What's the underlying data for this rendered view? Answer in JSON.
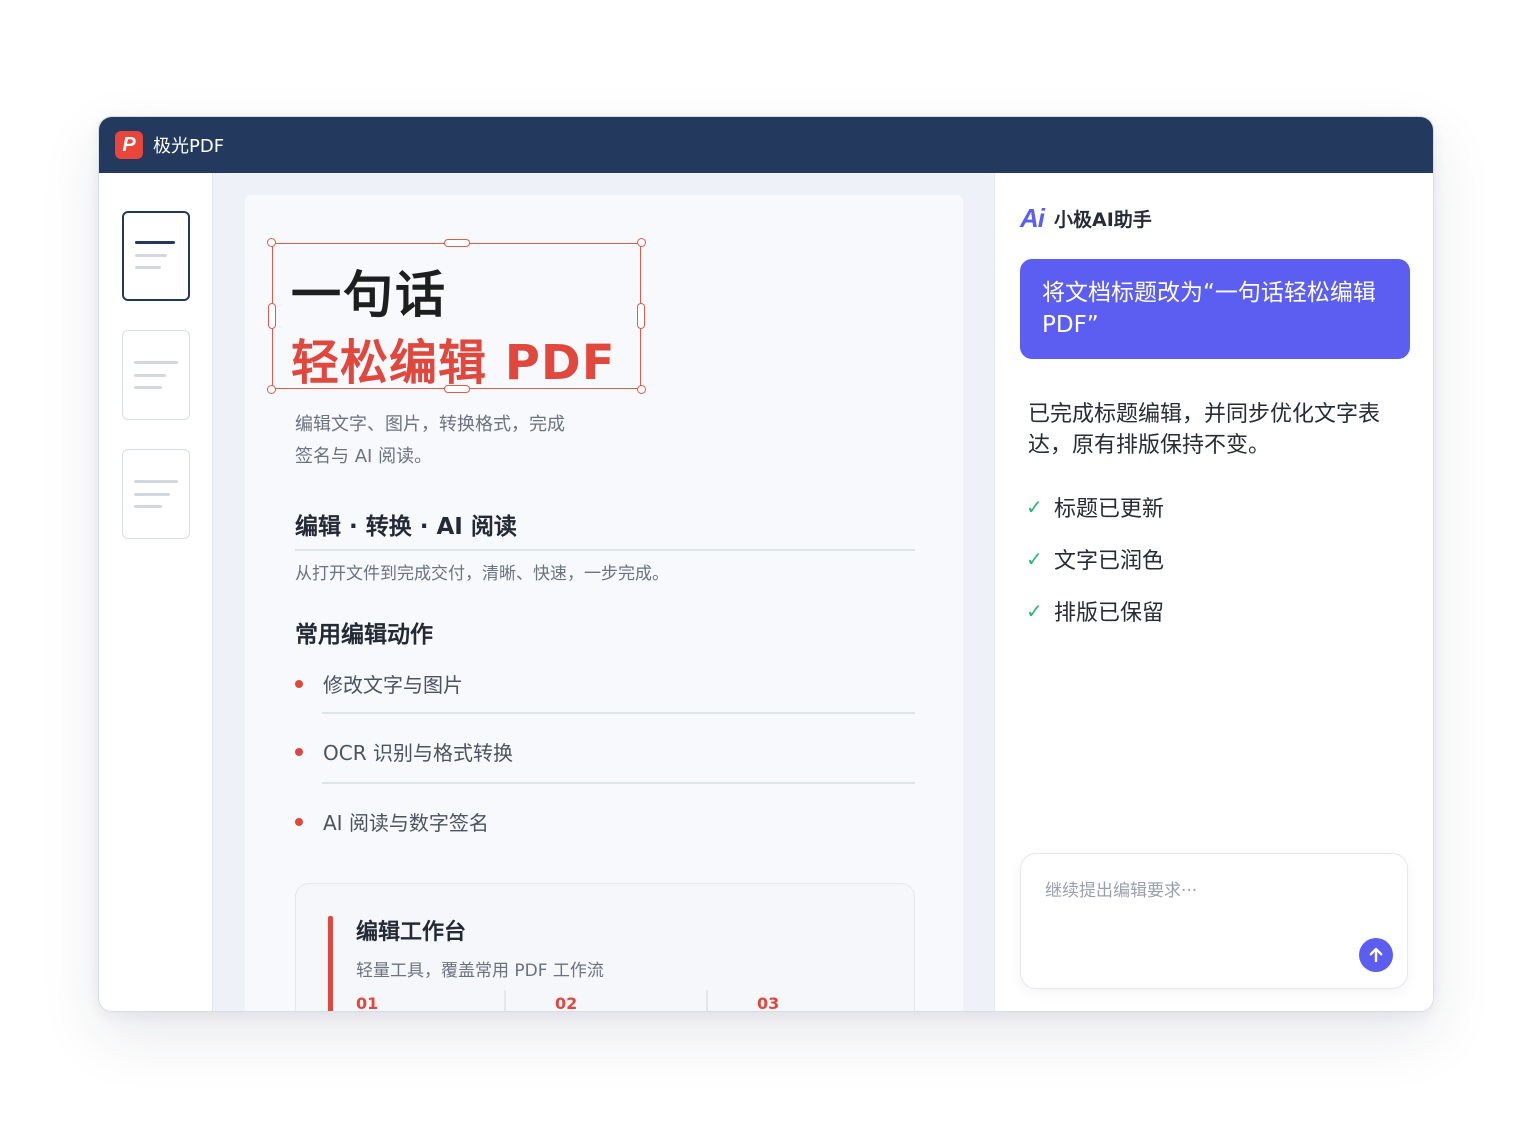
{
  "app": {
    "logo_letter": "P",
    "title": "极光PDF"
  },
  "document": {
    "title_line1": "一句话",
    "title_line2": "轻松编辑 PDF",
    "subtitle_line1": "编辑文字、图片，转换格式，完成",
    "subtitle_line2": "签名与 AI 阅读。",
    "section1_heading": "编辑 · 转换 · AI 阅读",
    "section1_text": "从打开文件到完成交付，清晰、快速，一步完成。",
    "section2_heading": "常用编辑动作",
    "actions": [
      "修改文字与图片",
      "OCR 识别与格式转换",
      "AI 阅读与数字签名"
    ],
    "card": {
      "title": "编辑工作台",
      "subtitle": "轻量工具，覆盖常用 PDF 工作流",
      "steps": [
        "01",
        "02",
        "03"
      ]
    }
  },
  "assistant": {
    "logo": "Ai",
    "name": "小极AI助手",
    "user_message": "将文档标题改为“一句话轻松编辑PDF”",
    "reply": "已完成标题编辑，并同步优化文字表达，原有排版保持不变。",
    "checks": [
      "标题已更新",
      "文字已润色",
      "排版已保留"
    ],
    "input_placeholder": "继续提出编辑要求···"
  },
  "colors": {
    "titlebar": "#233a5e",
    "brand_red": "#e0483d",
    "accent_purple": "#5b5ef0",
    "check_green": "#2bb673"
  }
}
